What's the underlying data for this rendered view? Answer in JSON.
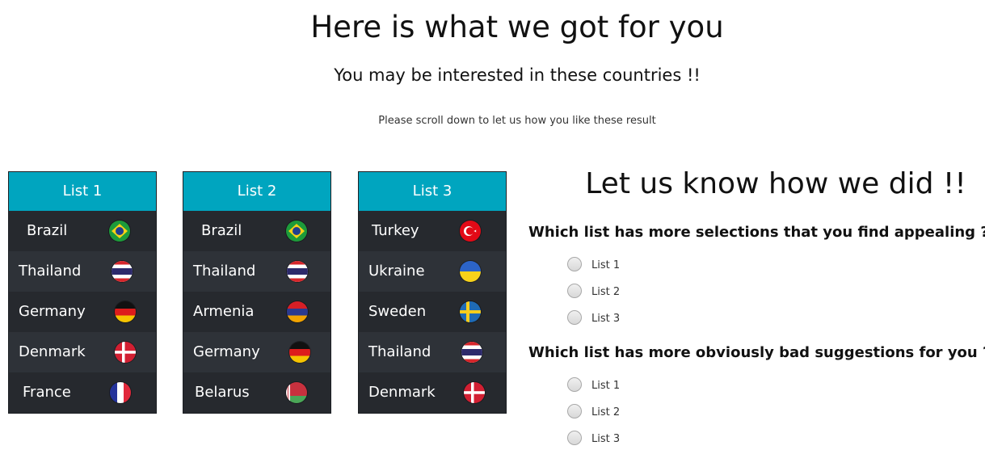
{
  "page": {
    "title": "Here is what we got for you",
    "subtitle": "You may be interested in these countries !!",
    "note": "Please scroll down to let us how you like these result"
  },
  "lists": [
    {
      "header": "List 1",
      "items": [
        {
          "country": "Brazil",
          "flag": "brazil-flag-icon"
        },
        {
          "country": "Thailand",
          "flag": "thailand-flag-icon"
        },
        {
          "country": "Germany",
          "flag": "germany-flag-icon"
        },
        {
          "country": "Denmark",
          "flag": "denmark-flag-icon"
        },
        {
          "country": "France",
          "flag": "france-flag-icon"
        }
      ]
    },
    {
      "header": "List 2",
      "items": [
        {
          "country": "Brazil",
          "flag": "brazil-flag-icon"
        },
        {
          "country": "Thailand",
          "flag": "thailand-flag-icon"
        },
        {
          "country": "Armenia",
          "flag": "armenia-flag-icon"
        },
        {
          "country": "Germany",
          "flag": "germany-flag-icon"
        },
        {
          "country": "Belarus",
          "flag": "belarus-flag-icon"
        }
      ]
    },
    {
      "header": "List 3",
      "items": [
        {
          "country": "Turkey",
          "flag": "turkey-flag-icon"
        },
        {
          "country": "Ukraine",
          "flag": "ukraine-flag-icon"
        },
        {
          "country": "Sweden",
          "flag": "sweden-flag-icon"
        },
        {
          "country": "Thailand",
          "flag": "thailand-flag-icon"
        },
        {
          "country": "Denmark",
          "flag": "denmark-flag-icon"
        }
      ]
    }
  ],
  "feedback": {
    "title": "Let us know how we did !!",
    "questions": [
      {
        "text": "Which list has more selections that you find appealing ?",
        "required_mark": "*",
        "suffix": ":",
        "options": [
          "List 1",
          "List 2",
          "List 3"
        ]
      },
      {
        "text": "Which list has more obviously bad suggestions for you ?",
        "required_mark": "*",
        "suffix": ":",
        "options": [
          "List 1",
          "List 2",
          "List 3"
        ]
      }
    ]
  },
  "colors": {
    "list_header": "#00a5bf",
    "list_body": "#2b2f35",
    "required_mark": "#4466cc"
  }
}
